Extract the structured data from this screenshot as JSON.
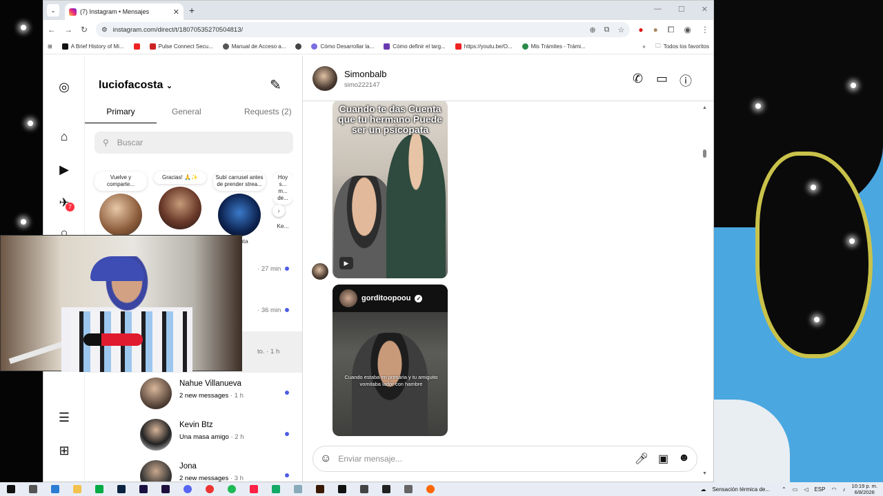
{
  "browser": {
    "tab_title": "(7) Instagram • Mensajes",
    "url": "instagram.com/direct/t/18070535270504813/",
    "bookmarks": [
      "A Brief History of Mi...",
      "Pulse Connect Secu...",
      "Manual de Acceso a...",
      "Cómo Desarrollar la...",
      "Cómo definir el targ...",
      "https://youtu.be/O...",
      "Mis Trámites - Trámi..."
    ],
    "all_bookmarks": "Todos los favoritos"
  },
  "inbox": {
    "account": "luciofacosta",
    "tabs": [
      "Primary",
      "General",
      "Requests (2)"
    ],
    "search_placeholder": "Buscar",
    "notification_count": "7",
    "notes": [
      {
        "text": "Vuelve y comparte...",
        "name": ""
      },
      {
        "text": "Gracias! 🙏✨",
        "name": ""
      },
      {
        "text": "Subí carrusel antes de prender strea...",
        "name": "...lanta"
      },
      {
        "text": "Hoy s... m... de...",
        "name": "Ke..."
      }
    ],
    "conversations": [
      {
        "name": "",
        "preview": "t...",
        "time": "27 min",
        "unread": true
      },
      {
        "name": "",
        "preview": "...",
        "time": "36 min",
        "unread": true
      },
      {
        "name": "",
        "preview": "to.",
        "time": "1 h",
        "unread": false
      },
      {
        "name": "Nahue Villanueva",
        "preview": "2 new messages",
        "time": "1 h",
        "unread": true
      },
      {
        "name": "Kevin Btz",
        "preview": "Una masa amigo",
        "time": "2 h",
        "unread": true
      },
      {
        "name": "Jona",
        "preview": "2 new messages",
        "time": "3 h",
        "unread": true
      }
    ]
  },
  "thread": {
    "name": "Simonbalb",
    "username": "simo222147",
    "reel1_caption": "Cuando te das Cuenta que tu hermano Puede ser un psicopata",
    "reel2_account": "gorditoopoou",
    "reel2_caption": "Cuando estaba en primaria y tu amiguito vomitaba lador con hambre",
    "composer_placeholder": "Enviar mensaje..."
  },
  "taskbar": {
    "weather": "Sensación térmica de...",
    "lang": "ESP",
    "time": "10:19 p. m.",
    "date": "6/8/2026"
  }
}
